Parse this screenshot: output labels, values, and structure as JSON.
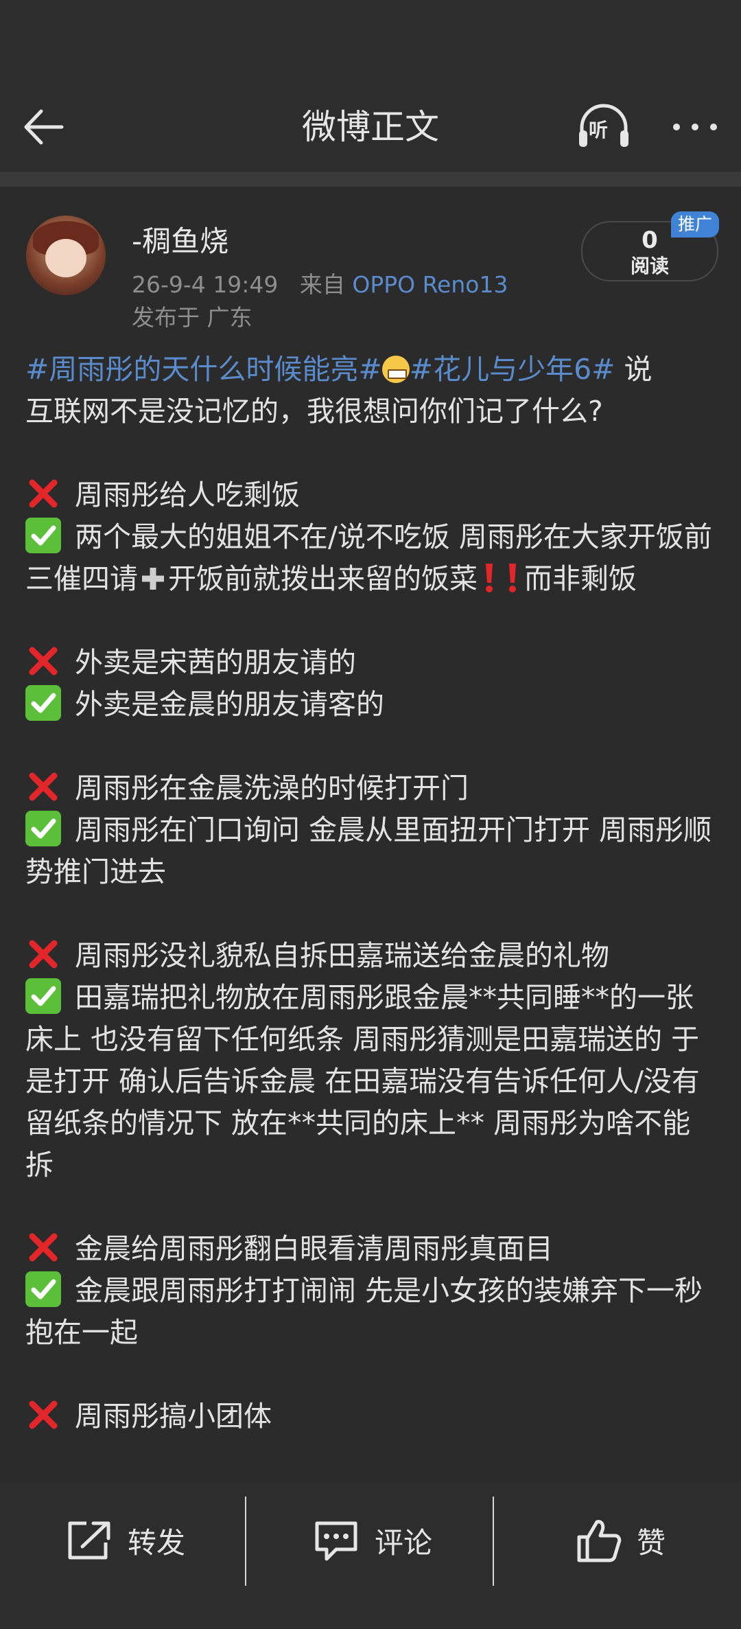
{
  "header": {
    "title": "微博正文",
    "listen_label": "听"
  },
  "post": {
    "author": "-稠鱼烧",
    "time": "26-9-4 19:49",
    "source_prefix": "来自",
    "device": "OPPO Reno13",
    "location": "发布于 广东",
    "read_count": "0",
    "read_label": "阅读",
    "promo_label": "推广"
  },
  "content": {
    "topic1": "#周雨彤的天什么时候能亮#",
    "topic2": "#花儿与少年6#",
    "intro_a": " 说",
    "intro_b": "互联网不是没记忆的，我很想问你们记了什么?",
    "pairs": [
      {
        "wrong": "周雨彤给人吃剩饭",
        "right": "两个最大的姐姐不在/说不吃饭 周雨彤在大家开饭前三催四请",
        "right_b": "开饭前就拨出来留的饭菜",
        "right_c": "而非剩饭"
      },
      {
        "wrong": "外卖是宋茜的朋友请的",
        "right": "外卖是金晨的朋友请客的"
      },
      {
        "wrong": "周雨彤在金晨洗澡的时候打开门",
        "right": "周雨彤在门口询问 金晨从里面扭开门打开 周雨彤顺势推门进去"
      },
      {
        "wrong": "周雨彤没礼貌私自拆田嘉瑞送给金晨的礼物",
        "right": "田嘉瑞把礼物放在周雨彤跟金晨**共同睡**的一张床上 也没有留下任何纸条 周雨彤猜测是田嘉瑞送的 于是打开 确认后告诉金晨 在田嘉瑞没有告诉任何人/没有留纸条的情况下 放在**共同的床上** 周雨彤为啥不能拆"
      },
      {
        "wrong": "金晨给周雨彤翻白眼看清周雨彤真面目",
        "right": "金晨跟周雨彤打打闹闹 先是小女孩的装嫌弃下一秒抱在一起"
      },
      {
        "wrong": "周雨彤搞小团体"
      }
    ]
  },
  "actions": {
    "repost": "转发",
    "comment": "评论",
    "like": "赞"
  },
  "colors": {
    "link": "#5a8ccd",
    "background": "#2b2b2b",
    "wrong_mark": "#e3262a",
    "right_mark": "#5cbf3a"
  }
}
